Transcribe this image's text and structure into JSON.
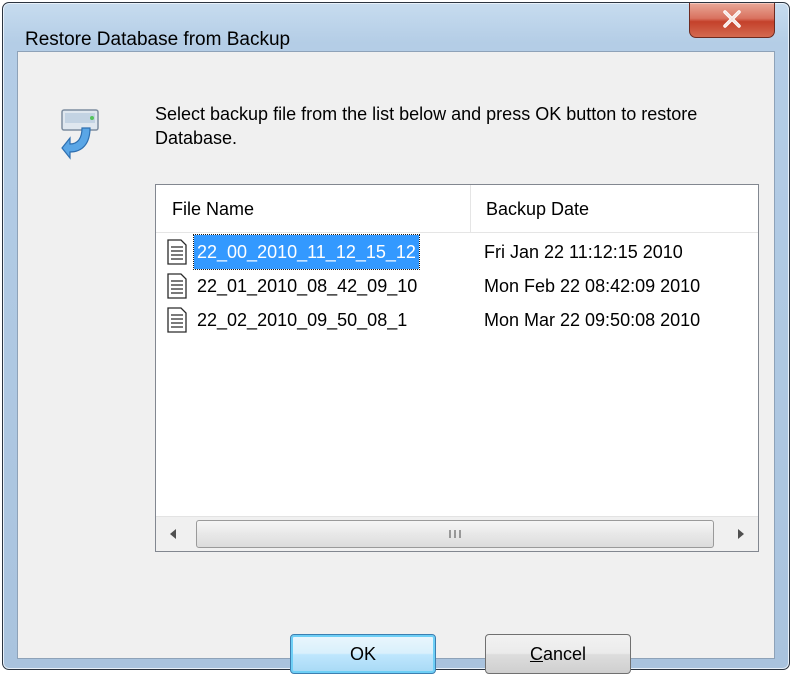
{
  "window": {
    "title": "Restore Database from Backup",
    "close_icon": "close-x-icon"
  },
  "message": "Select backup file from the list below and press OK button to restore Database.",
  "list": {
    "columns": [
      "File Name",
      "Backup Date"
    ],
    "rows": [
      {
        "name": "22_00_2010_11_12_15_12",
        "date": "Fri Jan 22 11:12:15 2010",
        "selected": true
      },
      {
        "name": "22_01_2010_08_42_09_10",
        "date": "Mon Feb 22 08:42:09 2010",
        "selected": false
      },
      {
        "name": "22_02_2010_09_50_08_1",
        "date": "Mon Mar 22 09:50:08 2010",
        "selected": false
      }
    ]
  },
  "buttons": {
    "ok": "OK",
    "cancel_accel": "C",
    "cancel_rest": "ancel"
  },
  "colors": {
    "selection": "#3399ff",
    "ok_focus": "#6ecff6",
    "close": "#c4412b"
  }
}
